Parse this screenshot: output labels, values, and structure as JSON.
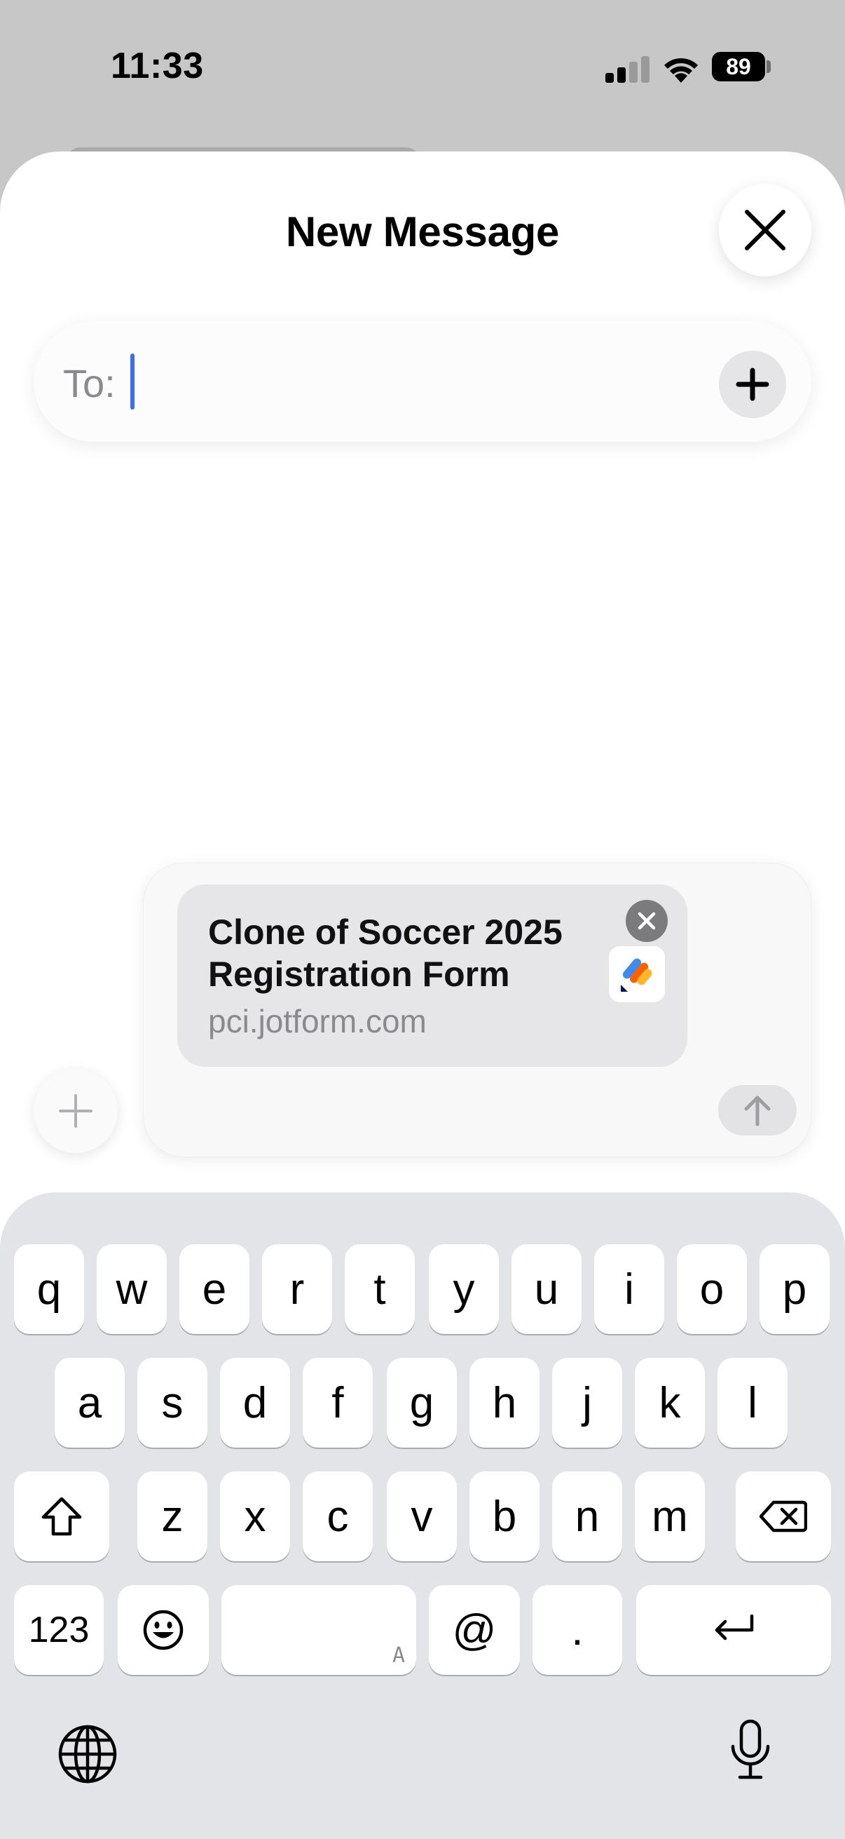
{
  "status": {
    "time": "11:33",
    "battery": "89"
  },
  "sheet": {
    "title": "New Message",
    "to_label": "To:",
    "to_value": ""
  },
  "compose": {
    "link": {
      "title": "Clone of Soccer 2025 Registration Form",
      "domain": "pci.jotform.com"
    }
  },
  "keyboard": {
    "row1": [
      "q",
      "w",
      "e",
      "r",
      "t",
      "y",
      "u",
      "i",
      "o",
      "p"
    ],
    "row2": [
      "a",
      "s",
      "d",
      "f",
      "g",
      "h",
      "j",
      "k",
      "l"
    ],
    "row3": [
      "z",
      "x",
      "c",
      "v",
      "b",
      "n",
      "m"
    ],
    "numbers_label": "123",
    "space_hint": "A",
    "at_label": "@",
    "period_label": "."
  },
  "icons": {
    "status": [
      "cellular-signal-icon",
      "wifi-icon",
      "battery-icon"
    ],
    "sheet": [
      "close-icon",
      "plus-icon"
    ],
    "compose": [
      "plus-icon",
      "close-icon",
      "jotform-logo-icon",
      "arrow-up-icon"
    ],
    "keyboard": [
      "shift-icon",
      "delete-icon",
      "emoji-icon",
      "return-icon",
      "globe-icon",
      "microphone-icon"
    ]
  }
}
